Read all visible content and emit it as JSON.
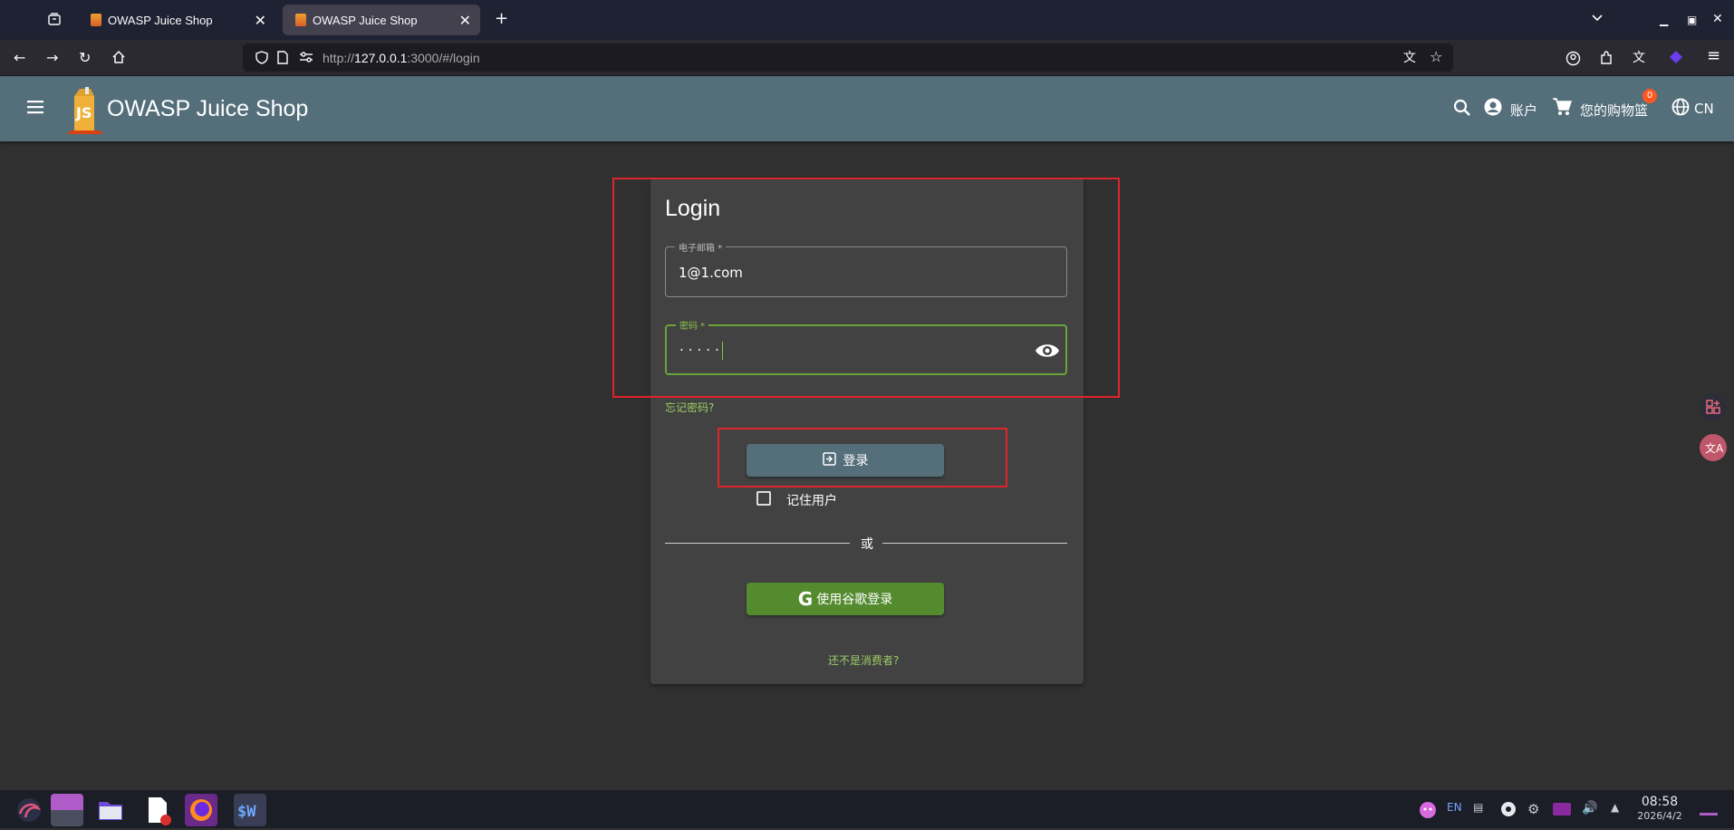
{
  "browser": {
    "tabs": [
      {
        "title": "OWASP Juice Shop",
        "active": false
      },
      {
        "title": "OWASP Juice Shop",
        "active": true
      }
    ],
    "new_tab_icon": "plus-icon",
    "url_prefix": "http://",
    "url_host": "127.0.0.1",
    "url_path": ":3000/#/login"
  },
  "app": {
    "title": "OWASP Juice Shop",
    "account_label": "账户",
    "basket_label": "您的购物篮",
    "basket_count": "0",
    "language_label": "CN",
    "accent_color": "#546e7a"
  },
  "login": {
    "title": "Login",
    "email_label": "电子邮箱 *",
    "email_value": "1@1.com",
    "password_label": "密码 *",
    "password_value": "·····",
    "forgot_password": "忘记密码?",
    "login_button": "登录",
    "remember_me": "记住用户",
    "divider_text": "或",
    "google_button": "使用谷歌登录",
    "not_customer": "还不是消费者?"
  },
  "taskbar": {
    "tray_lang": "EN",
    "time": "08:58",
    "date": "2026/4/2"
  }
}
